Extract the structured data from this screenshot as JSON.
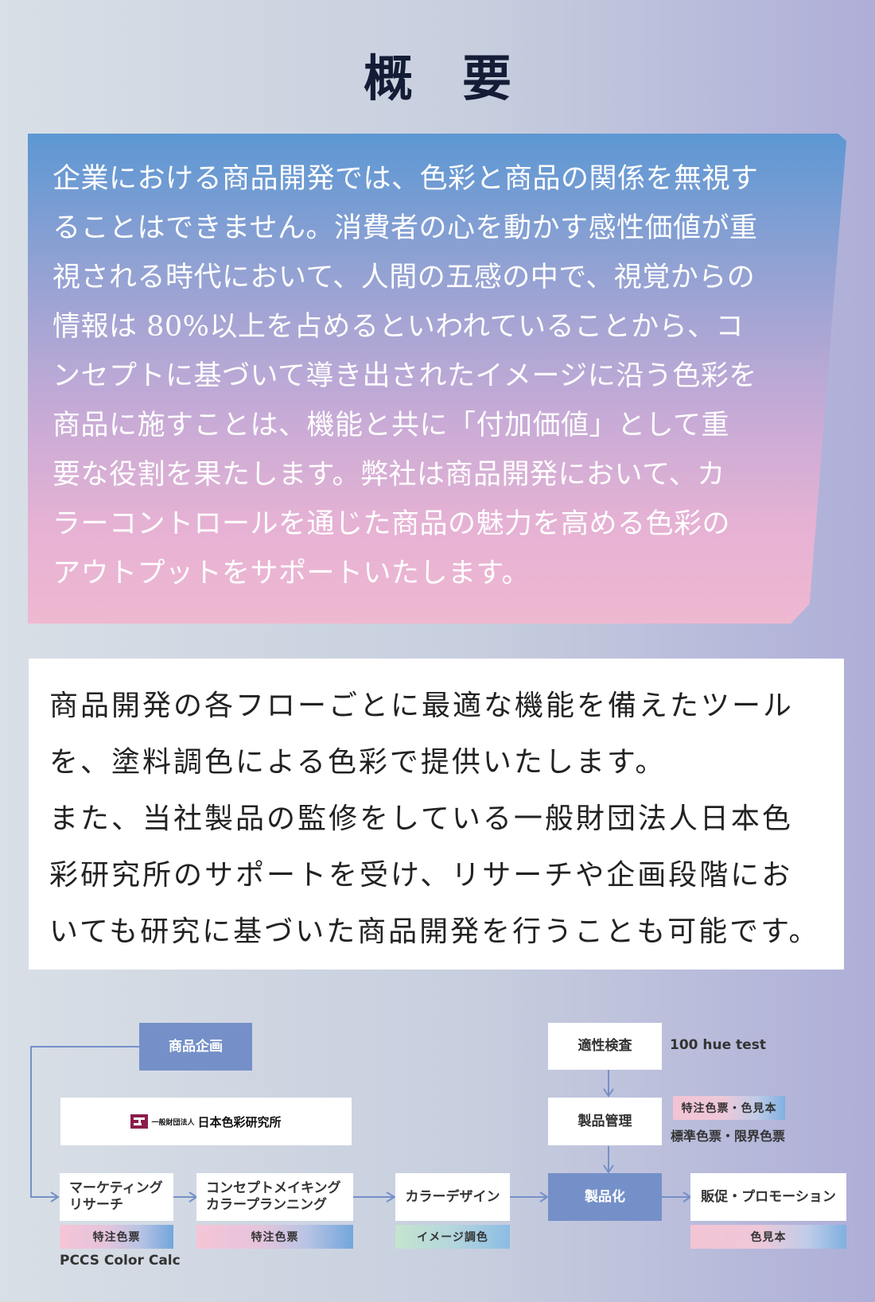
{
  "title": "概　要",
  "intro": {
    "lines": [
      "企業における商品開発では、色彩と商品の関係を無視す",
      "ることはできません。消費者の心を動かす感性価値が重",
      "視される時代において、人間の五感の中で、視覚からの",
      "情報は 80%以上を占めるといわれていることから、コ",
      "ンセプトに基づいて導き出されたイメージに沿う色彩を",
      "商品に施すことは、機能と共に「付加価値」として重",
      "要な役割を果たします。弊社は商品開発において、カ",
      "ラーコントロールを通じた商品の魅力を高める色彩の",
      "アウトプットをサポートいたします。"
    ]
  },
  "description": {
    "lines": [
      "商品開発の各フローごとに最適な機能を備えたツール",
      "を、塗料調色による色彩で提供いたします。",
      "また、当社製品の監修をしている一般財団法人日本色",
      "彩研究所のサポートを受け、リサーチや企画段階にお",
      "いても研究に基づいた商品開発を行うことも可能です。"
    ]
  },
  "flow": {
    "planning": "商品企画",
    "institute_logo": {
      "small": "一般財団法人",
      "big": "日本色彩研究所"
    },
    "marketing": {
      "line1": "マーケティング",
      "line2": "リサーチ"
    },
    "marketing_tag": "特注色票",
    "marketing_note": "PCCS Color Calc",
    "concept": {
      "line1": "コンセプトメイキング",
      "line2": "カラープランニング"
    },
    "concept_tag": "特注色票",
    "color_design": "カラーデザイン",
    "color_design_tag": "イメージ調色",
    "inspection": "適性検査",
    "inspection_note": "100 hue test",
    "product_management": "製品管理",
    "management_tag": "特注色票・色見本",
    "management_note": "標準色票・限界色票",
    "productization": "製品化",
    "promotion": "販促・プロモーション",
    "promotion_tag": "色見本"
  },
  "colors": {
    "node_blue": "#7590c8",
    "line_blue": "#7590c8",
    "title_navy": "#141c36",
    "logo_maroon": "#8b1e4c"
  }
}
